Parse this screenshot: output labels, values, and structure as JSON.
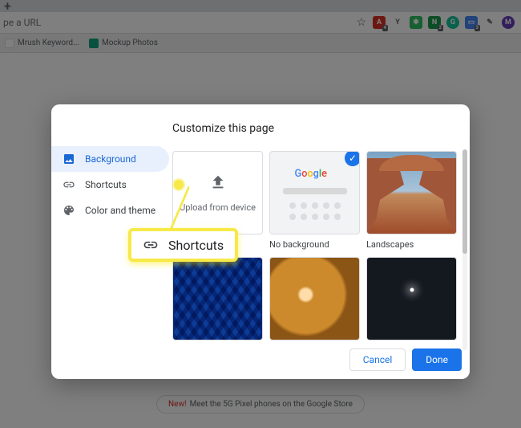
{
  "chrome": {
    "url_placeholder": "pe a URL",
    "bookmarks": [
      {
        "label": "Mrush Keyword...",
        "icon_color": "#fff"
      },
      {
        "label": "Mockup Photos",
        "icon_color": "#10a37f"
      }
    ],
    "extensions": [
      {
        "name": "pdf-ext-icon",
        "bg": "#d93025",
        "glyph": "⬚",
        "badge": "4"
      },
      {
        "name": "yandex-ext-icon",
        "bg": "transparent",
        "glyph": "Y",
        "color": "#5f6368"
      },
      {
        "name": "evernote-ext-icon",
        "bg": "#2dbe60",
        "glyph": "✎"
      },
      {
        "name": "onenote-ext-icon",
        "bg": "#1a9b4b",
        "glyph": "N",
        "badge": "2"
      },
      {
        "name": "grammarly-ext-icon",
        "bg": "#15c39a",
        "glyph": "G"
      },
      {
        "name": "chat-ext-icon",
        "bg": "#4285f4",
        "glyph": "▭",
        "badge": "3"
      },
      {
        "name": "quill-ext-icon",
        "bg": "transparent",
        "glyph": "✎",
        "color": "#5f6368"
      },
      {
        "name": "profile-ext-icon",
        "bg": "#673ab7",
        "glyph": "M"
      }
    ]
  },
  "promo": {
    "new_label": "New!",
    "text": "Meet the 5G Pixel phones on the Google Store"
  },
  "dialog": {
    "title": "Customize this page",
    "sidebar": {
      "items": [
        {
          "label": "Background",
          "icon": "background",
          "active": true
        },
        {
          "label": "Shortcuts",
          "icon": "link",
          "active": false
        },
        {
          "label": "Color and theme",
          "icon": "palette",
          "active": false
        }
      ]
    },
    "upload": {
      "text": "Upload from device"
    },
    "thumbs": {
      "no_background_label": "No background",
      "landscapes_label": "Landscapes",
      "google_text": "Google"
    },
    "footer": {
      "cancel": "Cancel",
      "done": "Done"
    }
  },
  "callout": {
    "text": "Shortcuts"
  }
}
